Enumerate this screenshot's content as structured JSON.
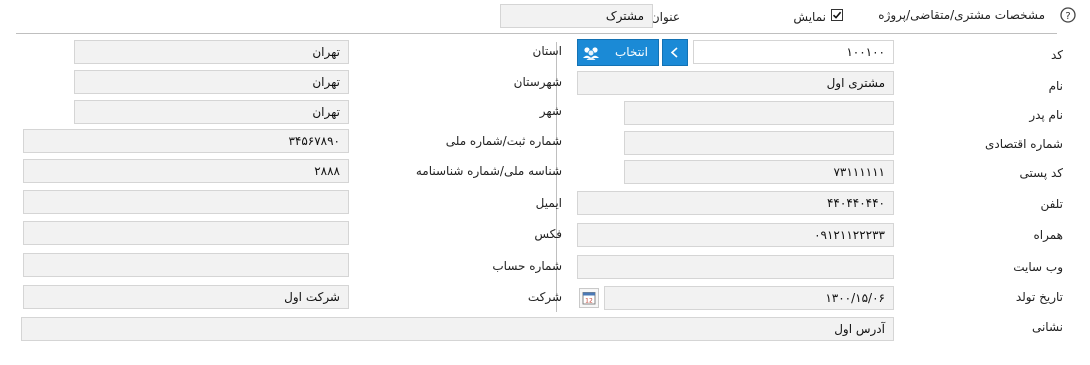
{
  "header": {
    "title": "مشخصات مشتری/متقاضی/پروژه",
    "show_label": "نمایش",
    "show_checked": true,
    "subject_label": "عنوان",
    "subject_value": "مشترک"
  },
  "right": {
    "code_label": "کد",
    "code_value": "۱۰۰۱۰۰",
    "select_button": "انتخاب",
    "name_label": "نام",
    "name_value": "مشتری اول",
    "father_label": "نام پدر",
    "father_value": "",
    "economic_label": "شماره اقتصادی",
    "economic_value": "",
    "postal_label": "کد پستی",
    "postal_value": "۷۳۱۱۱۱۱۱",
    "phone_label": "تلفن",
    "phone_value": "۴۴۰۴۴۰۴۴۰",
    "mobile_label": "همراه",
    "mobile_value": "۰۹۱۲۱۱۲۲۲۳۳",
    "website_label": "وب سایت",
    "website_value": "",
    "birth_label": "تاریخ تولد",
    "birth_value": "۱۳۰۰/۱۵/۰۶",
    "address_label": "نشانی",
    "address_value": "آدرس اول"
  },
  "left": {
    "province_label": "استان",
    "province_value": "تهران",
    "county_label": "شهرستان",
    "county_value": "تهران",
    "city_label": "شهر",
    "city_value": "تهران",
    "regno_label": "شماره ثبت/شماره ملی",
    "regno_value": "۳۴۵۶۷۸۹۰",
    "nationalid_label": "شناسه ملی/شماره شناسنامه",
    "nationalid_value": "۲۸۸۸",
    "email_label": "ایمیل",
    "email_value": "",
    "fax_label": "فکس",
    "fax_value": "",
    "account_label": "شماره حساب",
    "account_value": "",
    "company_label": "شرکت",
    "company_value": "شرکت اول"
  },
  "icons": {
    "help": "help-icon",
    "select": "users-icon",
    "back": "arrow-icon",
    "calendar": "calendar-icon"
  },
  "colors": {
    "accent": "#1b8ad6",
    "field_bg": "#f2f2f2",
    "field_border": "#d5d5d5"
  }
}
